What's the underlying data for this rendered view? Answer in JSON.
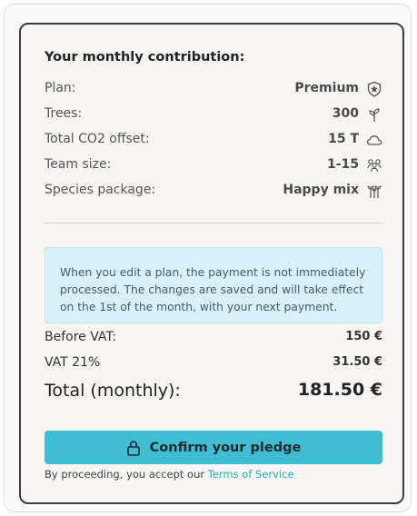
{
  "contribution": {
    "title": "Your monthly contribution:",
    "rows": [
      {
        "label": "Plan:",
        "value": "Premium",
        "icon": "shield-icon"
      },
      {
        "label": "Trees:",
        "value": "300",
        "icon": "sprout-icon"
      },
      {
        "label": "Total CO2 offset:",
        "value": "15 T",
        "icon": "cloud-icon"
      },
      {
        "label": "Team size:",
        "value": "1-15",
        "icon": "team-icon"
      },
      {
        "label": "Species package:",
        "value": "Happy mix",
        "icon": "plants-icon"
      }
    ]
  },
  "notice": {
    "text": "When you edit a plan, the payment is not immediately processed. The changes are saved and will take effect on the 1st of the month, with your next payment."
  },
  "summary": {
    "before_vat_label": "Before VAT:",
    "before_vat_value": "150 €",
    "vat_label": "VAT 21%",
    "vat_value": "31.50 €",
    "total_label": "Total (monthly):",
    "total_value": "181.50 €"
  },
  "confirm": {
    "label": "Confirm your pledge",
    "icon": "lock-icon"
  },
  "terms": {
    "prefix": "By proceeding, you accept our ",
    "link": "Terms of Service"
  },
  "colors": {
    "accent": "#40bcd3",
    "link": "#2ca7c4",
    "notice_bg": "#d8f1fa",
    "card_border": "#3c3c3c"
  }
}
